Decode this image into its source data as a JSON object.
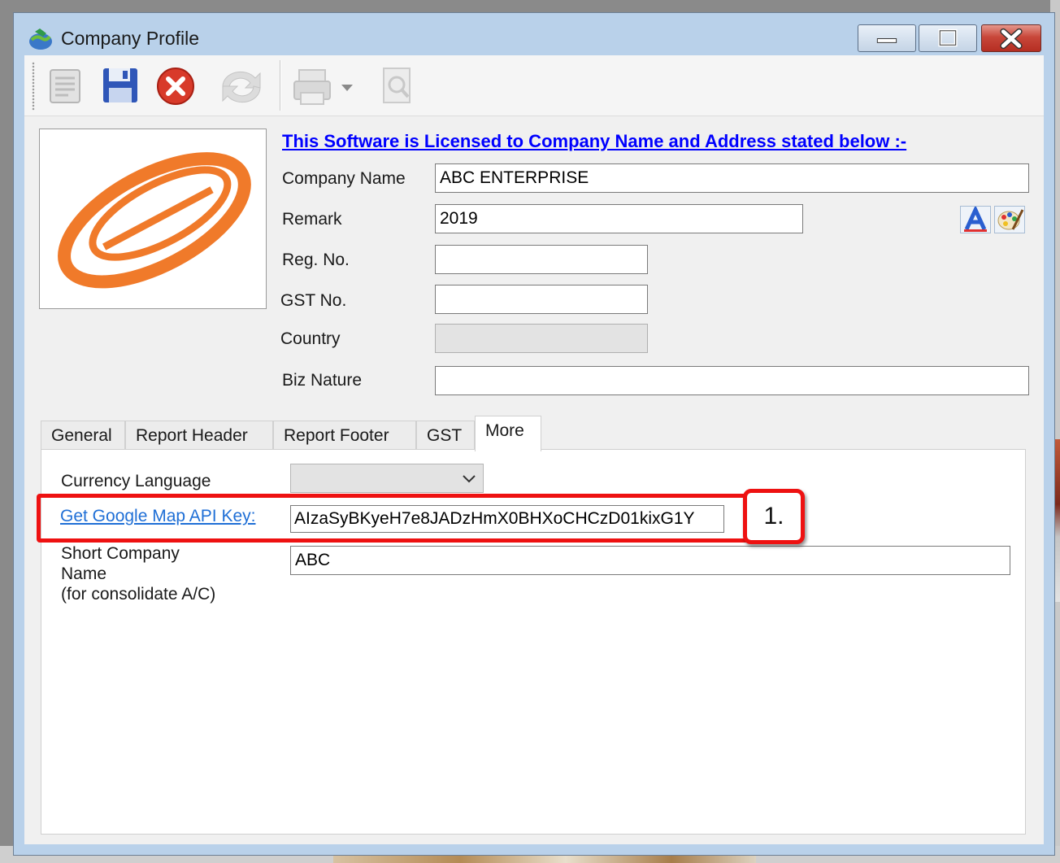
{
  "window": {
    "title": "Company Profile"
  },
  "toolbar": {
    "buttons": [
      {
        "name": "edit",
        "icon": "edit-document-icon",
        "enabled": false
      },
      {
        "name": "save",
        "icon": "floppy-disk-icon",
        "enabled": true
      },
      {
        "name": "cancel",
        "icon": "cancel-x-icon",
        "enabled": true
      },
      {
        "name": "refresh",
        "icon": "refresh-arrows-icon",
        "enabled": false
      },
      {
        "name": "print",
        "icon": "printer-icon",
        "enabled": false
      },
      {
        "name": "preview",
        "icon": "print-preview-icon",
        "enabled": false
      }
    ]
  },
  "license_notice": "This Software is Licensed to Company Name and Address stated below :-",
  "form": {
    "company_name": {
      "label": "Company Name",
      "value": "ABC ENTERPRISE"
    },
    "remark": {
      "label": "Remark",
      "value": "2019"
    },
    "reg_no": {
      "label": "Reg. No.",
      "value": ""
    },
    "gst_no": {
      "label": "GST No.",
      "value": ""
    },
    "country": {
      "label": "Country",
      "value": ""
    },
    "biz_nature": {
      "label": "Biz Nature",
      "value": ""
    }
  },
  "tabs": [
    {
      "label": "General",
      "active": false
    },
    {
      "label": "Report Header",
      "active": false
    },
    {
      "label": "Report Footer",
      "active": false
    },
    {
      "label": "GST",
      "active": false
    },
    {
      "label": "More",
      "active": true
    }
  ],
  "more_tab": {
    "currency_language": {
      "label": "Currency Language",
      "value": ""
    },
    "google_map": {
      "link_label": "Get Google Map API Key:",
      "value": "AIzaSyBKyeH7e8JADzHmX0BHXoCHCzD01kixG1Y"
    },
    "short_company_name": {
      "label_lines": [
        "Short Company",
        "Name",
        "(for consolidate A/C)"
      ],
      "value": "ABC"
    }
  },
  "annotation": {
    "callout_label": "1.",
    "color": "#ee1111"
  },
  "colors": {
    "license_link": "#0000ff",
    "api_link": "#1f6fd6",
    "logo_orange": "#f07a2a"
  }
}
